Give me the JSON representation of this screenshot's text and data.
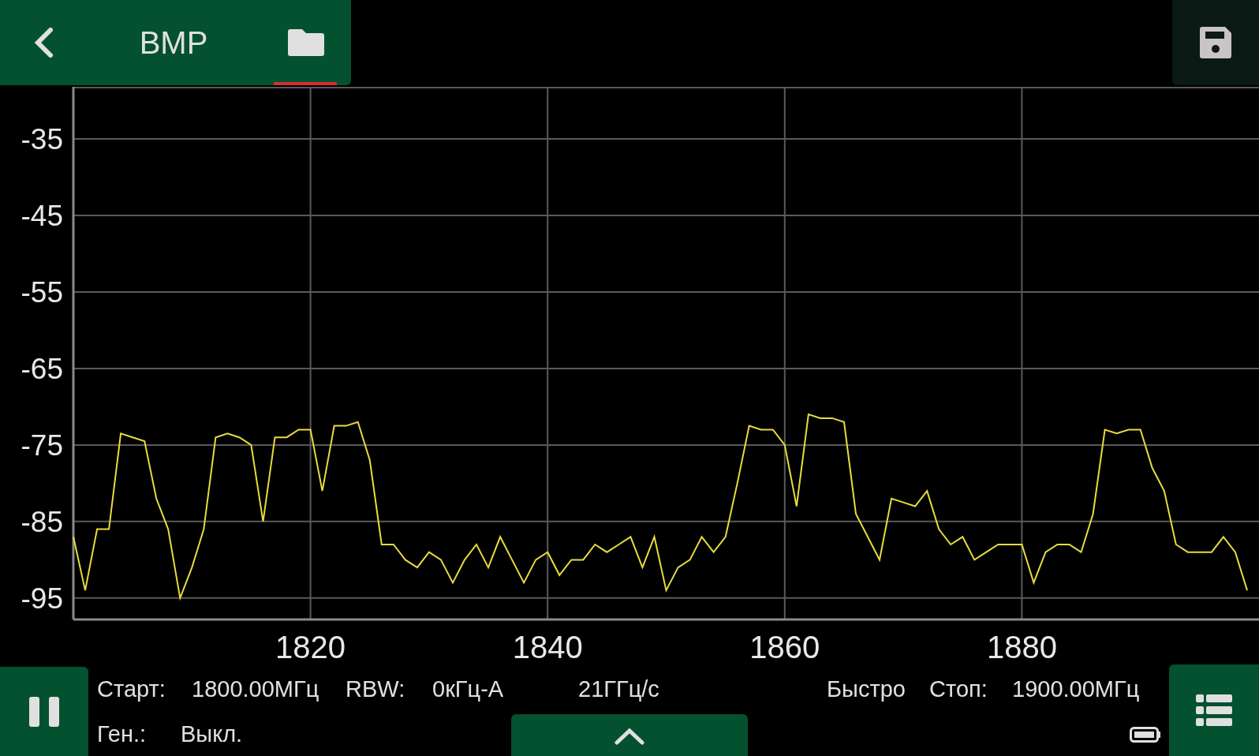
{
  "toolbar": {
    "title": "BMP",
    "folder_active": true
  },
  "chart": {
    "chart_data": {
      "type": "line",
      "xlim": [
        1800,
        1900
      ],
      "ylim": [
        -97.8,
        -28.2
      ],
      "xticks": [
        1820,
        1840,
        1860,
        1880
      ],
      "yticks": [
        -35,
        -45,
        -55,
        -65,
        -75,
        -85,
        -95
      ],
      "grid": true,
      "x": [
        1800,
        1801,
        1802,
        1803,
        1804,
        1805,
        1806,
        1807,
        1808,
        1809,
        1810,
        1811,
        1812,
        1813,
        1814,
        1815,
        1816,
        1817,
        1818,
        1819,
        1820,
        1821,
        1822,
        1823,
        1824,
        1825,
        1826,
        1827,
        1828,
        1829,
        1830,
        1831,
        1832,
        1833,
        1834,
        1835,
        1836,
        1837,
        1838,
        1839,
        1840,
        1841,
        1842,
        1843,
        1844,
        1845,
        1846,
        1847,
        1848,
        1849,
        1850,
        1851,
        1852,
        1853,
        1854,
        1855,
        1856,
        1857,
        1858,
        1859,
        1860,
        1861,
        1862,
        1863,
        1864,
        1865,
        1866,
        1867,
        1868,
        1869,
        1870,
        1871,
        1872,
        1873,
        1874,
        1875,
        1876,
        1877,
        1878,
        1879,
        1880,
        1881,
        1882,
        1883,
        1884,
        1885,
        1886,
        1887,
        1888,
        1889,
        1890,
        1891,
        1892,
        1893,
        1894,
        1895,
        1896,
        1897,
        1898,
        1899
      ],
      "series": [
        {
          "color": "#e8dc3c",
          "values": [
            -87,
            -94,
            -86,
            -86,
            -73.5,
            -74,
            -74.5,
            -82,
            -86,
            -95,
            -91,
            -86,
            -74,
            -73.5,
            -74,
            -75,
            -85,
            -74,
            -74,
            -73,
            -73,
            -81,
            -72.5,
            -72.5,
            -72,
            -77,
            -88,
            -88,
            -90,
            -91,
            -89,
            -90,
            -93,
            -90,
            -88,
            -91,
            -87,
            -90,
            -93,
            -90,
            -89,
            -92,
            -90,
            -90,
            -88,
            -89,
            -88,
            -87,
            -91,
            -87,
            -94,
            -91,
            -90,
            -87,
            -89,
            -87,
            -80,
            -72.5,
            -73,
            -73,
            -75,
            -83,
            -71,
            -71.5,
            -71.5,
            -72,
            -84,
            -87,
            -90,
            -82,
            -82.5,
            -83,
            -81,
            -86,
            -88,
            -87,
            -90,
            -89,
            -88,
            -88,
            -88,
            -93,
            -89,
            -88,
            -88,
            -89,
            -84,
            -73,
            -73.5,
            -73,
            -73,
            -78,
            -81,
            -88,
            -89,
            -89,
            -89,
            -87,
            -89,
            -94
          ]
        }
      ]
    }
  },
  "status": {
    "row_1": [
      "Старт:",
      "1800.00МГц",
      "RBW:",
      "0кГц-А",
      "21ГГц/с",
      "Быстро",
      "Стоп:",
      "1900.00МГц"
    ],
    "row_2": [
      "Ген.:",
      "Выкл."
    ]
  }
}
